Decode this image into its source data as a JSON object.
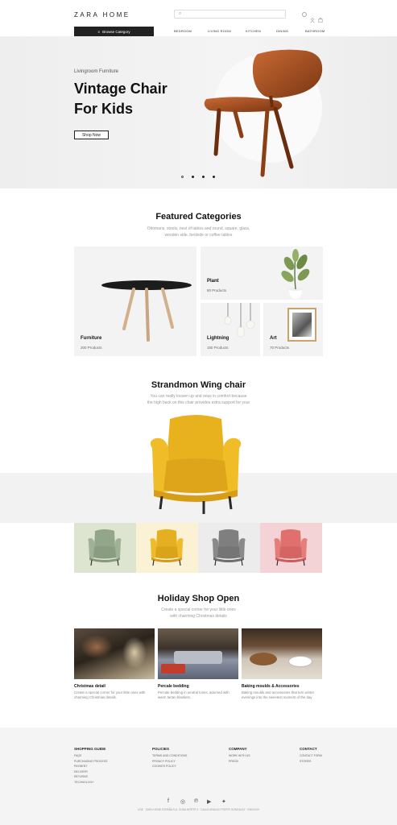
{
  "header": {
    "logo": "ZARA HOME",
    "search_placeholder": "",
    "browse_label": "Browse Category",
    "nav": [
      "BEDROOM",
      "LIVING ROOM",
      "KITCHEN",
      "DINING",
      "BATHROOM"
    ]
  },
  "hero": {
    "subtitle": "Livingroom Furniture",
    "title_line1": "Vintage Chair",
    "title_line2": "For Kids",
    "button": "Shop Now",
    "active_slide": 1,
    "slide_count": 4
  },
  "featured": {
    "title": "Featured Categories",
    "desc1": "Ottomans, stools, nest of tables and round, square, glass,",
    "desc2": "wooden side, bedside or coffee tables",
    "cards": [
      {
        "name": "Furniture",
        "count": "200 Products"
      },
      {
        "name": "Plant",
        "count": "80 Products"
      },
      {
        "name": "Lightning",
        "count": "150 Products"
      },
      {
        "name": "Art",
        "count": "70 Products"
      }
    ]
  },
  "strandmon": {
    "title": "Strandmon Wing chair",
    "desc1": "You can really loosen up and relax in comfort because",
    "desc2": "the high back on this chair provides extra support for your",
    "swatches": [
      "#dde5d0",
      "#fbf2d6",
      "#ececec",
      "#f3d3d5"
    ]
  },
  "holiday": {
    "title": "Holiday Shop Open",
    "desc1": "Create a special corner for your little ones",
    "desc2": "with charming Christmas details",
    "items": [
      {
        "title": "Christmas detail",
        "d1": "Create a special corner for your little ones with",
        "d2": "charming Christmas details."
      },
      {
        "title": "Percale bedding",
        "d1": "Percale bedding in neutral tones, adorned with",
        "d2": "warm tartan blankets."
      },
      {
        "title": "Baking moulds & Accessories",
        "d1": "Baking moulds and accessories that turn winter",
        "d2": "evenings into the sweetest moment of the day."
      }
    ]
  },
  "footer": {
    "cols": [
      {
        "title": "SHOPPING GUIDE",
        "links": [
          "FAQS",
          "PURCHASING PROCESS",
          "PAYMENT",
          "DELIVERY",
          "RETURNS",
          "TECHNOLOGY"
        ]
      },
      {
        "title": "POLICIES",
        "links": [
          "TERMS AND CONDITIONS",
          "PRIVACY POLICY",
          "COOKIES POLICY"
        ]
      },
      {
        "title": "COMPANY",
        "links": [
          "WORK WITH US",
          "PRESS"
        ]
      },
      {
        "title": "CONTACT",
        "links": [
          "CONTACT FORM",
          "STORES"
        ]
      }
    ],
    "social": [
      "facebook-icon",
      "instagram-icon",
      "pinterest-icon",
      "youtube-icon",
      "twitter-icon"
    ],
    "copyright": "USE · ZARA HOME ESPAÑA S.A. ZONA NORTE 3 · CALLE ARAUJO PORTE GONZALEZ · ENGLISH"
  }
}
